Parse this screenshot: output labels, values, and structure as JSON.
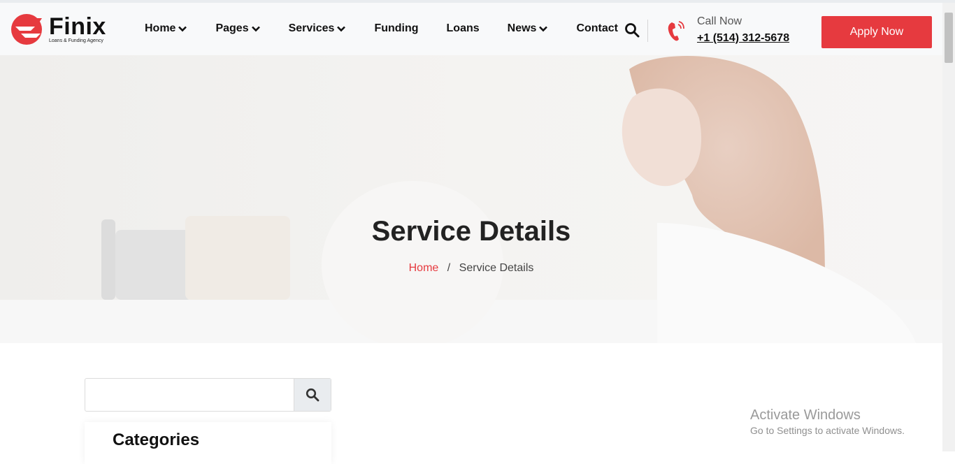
{
  "brand": {
    "name": "Finix",
    "tagline": "Loans & Funding Agency",
    "accent": "#e63a3f"
  },
  "nav": {
    "items": [
      {
        "label": "Home",
        "dropdown": true
      },
      {
        "label": "Pages",
        "dropdown": true
      },
      {
        "label": "Services",
        "dropdown": true
      },
      {
        "label": "Funding",
        "dropdown": false
      },
      {
        "label": "Loans",
        "dropdown": false
      },
      {
        "label": "News",
        "dropdown": true
      },
      {
        "label": "Contact",
        "dropdown": false
      }
    ],
    "search_icon": "search-icon"
  },
  "contact": {
    "call_label": "Call Now",
    "phone": "+1 (514) 312-5678",
    "icon": "phone-ringing-icon"
  },
  "apply_button": {
    "label": "Apply Now"
  },
  "hero": {
    "title": "Service Details",
    "breadcrumb": {
      "home": "Home",
      "separator": "/",
      "current": "Service Details"
    }
  },
  "sidebar": {
    "search": {
      "placeholder": "",
      "value": "",
      "icon": "search-icon"
    },
    "categories_title": "Categories"
  },
  "watermark": {
    "title": "Activate Windows",
    "subtitle": "Go to Settings to activate Windows."
  }
}
